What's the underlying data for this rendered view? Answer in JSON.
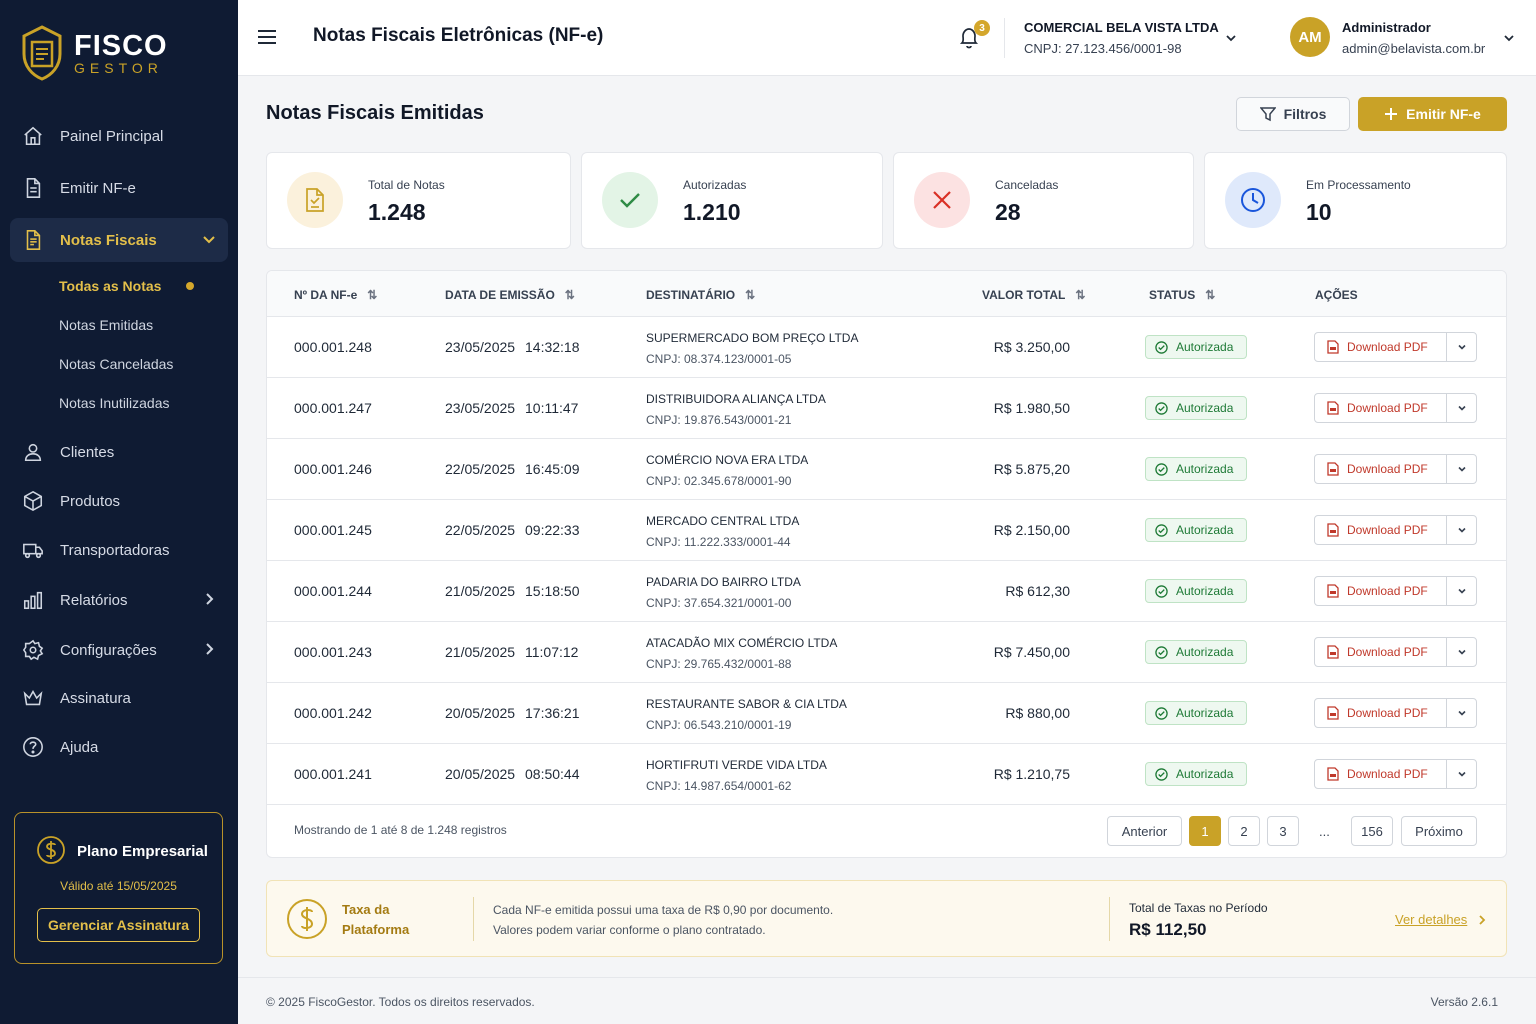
{
  "brand": {
    "title": "FISCO",
    "subtitle": "GESTOR"
  },
  "colors": {
    "sidebar": "#0f1b33",
    "accent": "#c9a227",
    "success": "#1e7a36",
    "danger": "#d93025",
    "info": "#1a56db"
  },
  "sidebar": {
    "items": [
      {
        "label": "Painel Principal",
        "icon": "home-icon"
      },
      {
        "label": "Emitir NF-e",
        "icon": "document-icon"
      },
      {
        "label": "Notas Fiscais",
        "icon": "invoice-icon"
      },
      {
        "label": "Clientes",
        "icon": "user-icon"
      },
      {
        "label": "Produtos",
        "icon": "box-icon"
      },
      {
        "label": "Transportadoras",
        "icon": "truck-icon"
      },
      {
        "label": "Relatórios",
        "icon": "bar-chart-icon"
      },
      {
        "label": "Configurações",
        "icon": "gear-icon"
      },
      {
        "label": "Assinatura",
        "icon": "crown-icon"
      },
      {
        "label": "Ajuda",
        "icon": "help-icon"
      }
    ],
    "subitems": [
      "Todas as Notas",
      "Notas Emitidas",
      "Notas Canceladas",
      "Notas Inutilizadas"
    ],
    "plan": {
      "name": "Plano Empresarial",
      "valid": "Válido até 15/05/2025",
      "button": "Gerenciar Assinatura"
    }
  },
  "header": {
    "title": "Notas Fiscais Eletrônicas (NF-e)",
    "notifications": "3",
    "company": {
      "name": "COMERCIAL BELA VISTA LTDA",
      "cnpj": "CNPJ: 27.123.456/0001-98"
    },
    "user": {
      "initials": "AM",
      "name": "Administrador",
      "email": "admin@belavista.com.br"
    }
  },
  "main": {
    "title": "Notas Fiscais Emitidas",
    "filter_label": "Filtros",
    "emit_label": "Emitir NF-e",
    "stats": [
      {
        "label": "Total de Notas",
        "value": "1.248"
      },
      {
        "label": "Autorizadas",
        "value": "1.210"
      },
      {
        "label": "Canceladas",
        "value": "28"
      },
      {
        "label": "Em Processamento",
        "value": "10"
      }
    ],
    "table": {
      "headers": [
        "Nº DA NF-e",
        "DATA DE EMISSÃO",
        "DESTINATÁRIO",
        "VALOR TOTAL",
        "STATUS",
        "AÇÕES"
      ],
      "rows": [
        {
          "num": "000.001.248",
          "date": "23/05/2025",
          "time": "14:32:18",
          "name": "SUPERMERCADO BOM PREÇO LTDA",
          "cnpj": "CNPJ: 08.374.123/0001-05",
          "value": "R$ 3.250,00",
          "status": "Autorizada",
          "action": "Download PDF"
        },
        {
          "num": "000.001.247",
          "date": "23/05/2025",
          "time": "10:11:47",
          "name": "DISTRIBUIDORA ALIANÇA LTDA",
          "cnpj": "CNPJ: 19.876.543/0001-21",
          "value": "R$ 1.980,50",
          "status": "Autorizada",
          "action": "Download PDF"
        },
        {
          "num": "000.001.246",
          "date": "22/05/2025",
          "time": "16:45:09",
          "name": "COMÉRCIO NOVA ERA LTDA",
          "cnpj": "CNPJ: 02.345.678/0001-90",
          "value": "R$ 5.875,20",
          "status": "Autorizada",
          "action": "Download PDF"
        },
        {
          "num": "000.001.245",
          "date": "22/05/2025",
          "time": "09:22:33",
          "name": "MERCADO CENTRAL LTDA",
          "cnpj": "CNPJ: 11.222.333/0001-44",
          "value": "R$ 2.150,00",
          "status": "Autorizada",
          "action": "Download PDF"
        },
        {
          "num": "000.001.244",
          "date": "21/05/2025",
          "time": "15:18:50",
          "name": "PADARIA DO BAIRRO LTDA",
          "cnpj": "CNPJ: 37.654.321/0001-00",
          "value": "R$ 612,30",
          "status": "Autorizada",
          "action": "Download PDF"
        },
        {
          "num": "000.001.243",
          "date": "21/05/2025",
          "time": "11:07:12",
          "name": "ATACADÃO MIX COMÉRCIO LTDA",
          "cnpj": "CNPJ: 29.765.432/0001-88",
          "value": "R$ 7.450,00",
          "status": "Autorizada",
          "action": "Download PDF"
        },
        {
          "num": "000.001.242",
          "date": "20/05/2025",
          "time": "17:36:21",
          "name": "RESTAURANTE SABOR & CIA LTDA",
          "cnpj": "CNPJ: 06.543.210/0001-19",
          "value": "R$ 880,00",
          "status": "Autorizada",
          "action": "Download PDF"
        },
        {
          "num": "000.001.241",
          "date": "20/05/2025",
          "time": "08:50:44",
          "name": "HORTIFRUTI VERDE VIDA LTDA",
          "cnpj": "CNPJ: 14.987.654/0001-62",
          "value": "R$ 1.210,75",
          "status": "Autorizada",
          "action": "Download PDF"
        }
      ]
    },
    "pagination": {
      "showing": "Mostrando de 1 até 8 de 1.248 registros",
      "prev": "Anterior",
      "pages": [
        "1",
        "2",
        "3"
      ],
      "ellipsis": "...",
      "last": "156",
      "next": "Próximo"
    },
    "fee": {
      "title": "Taxa da Plataforma",
      "desc1": "Cada NF-e emitida possui uma taxa de R$ 0,90 por documento.",
      "desc2": "Valores podem variar conforme o plano contratado.",
      "total_label": "Total de Taxas no Período",
      "total_value": "R$ 112,50",
      "link": "Ver detalhes"
    }
  },
  "footer": {
    "copyright": "© 2025 FiscoGestor. Todos os direitos reservados.",
    "version": "Versão 2.6.1"
  }
}
